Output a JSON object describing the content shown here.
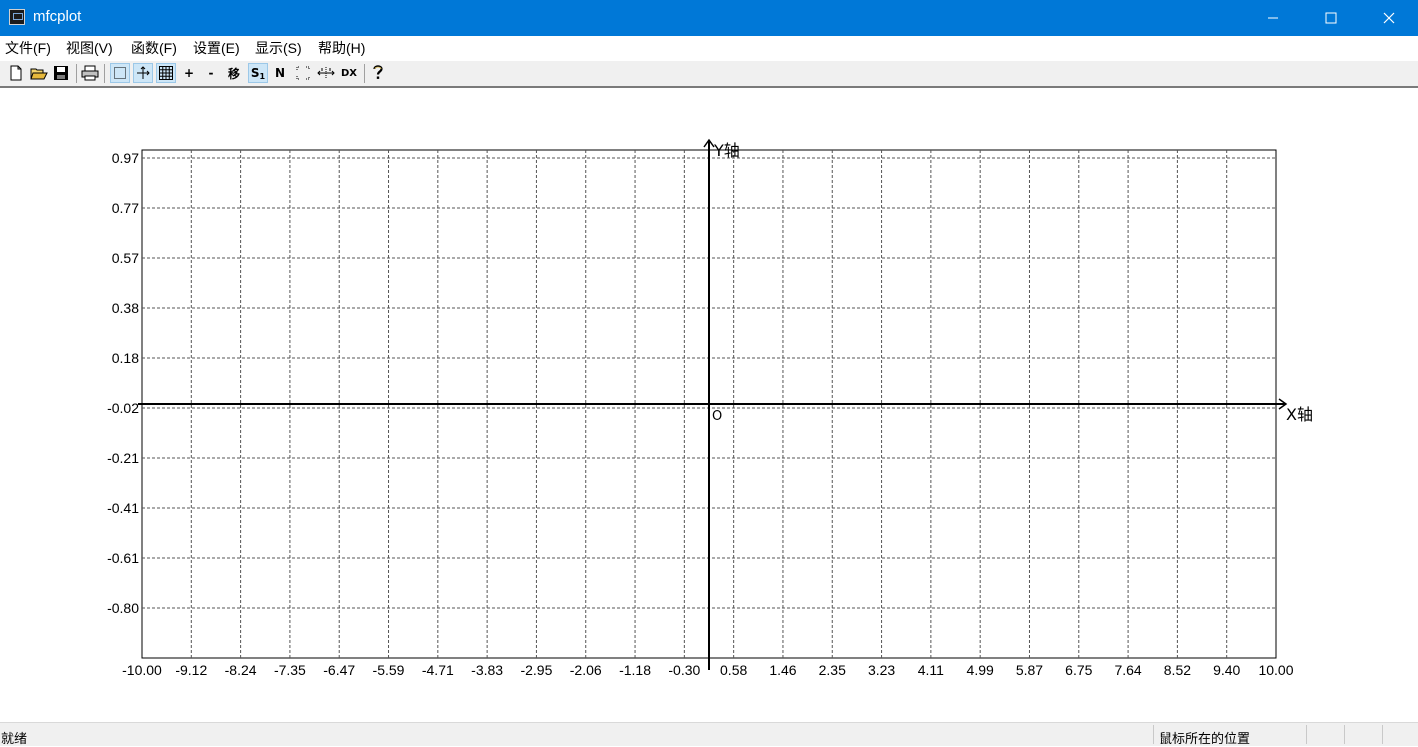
{
  "window": {
    "title": "mfcplot",
    "minimize_icon": "minimize-icon",
    "maximize_icon": "maximize-icon",
    "close_icon": "close-icon"
  },
  "menu": [
    {
      "label": "文件(F)"
    },
    {
      "label": "视图(V)"
    },
    {
      "label": "函数(F)"
    },
    {
      "label": "设置(E)"
    },
    {
      "label": "显示(S)"
    },
    {
      "label": "帮助(H)"
    }
  ],
  "toolbar": {
    "new_icon": "new-file-icon",
    "open_icon": "open-folder-icon",
    "save_icon": "save-icon",
    "print_icon": "print-icon",
    "select_icon": "select-rect-icon",
    "axis_icon": "axis-icon",
    "grid_icon": "grid-icon",
    "zoom_in": "+",
    "zoom_out": "-",
    "move": "移",
    "s_label": "S",
    "s_sub": "1",
    "n_label": "N",
    "dx_label": "DX",
    "help_icon": "help-icon"
  },
  "chart_data": {
    "type": "line",
    "xlabel": "X轴",
    "ylabel": "Y轴",
    "origin_label": "O",
    "xlim": [
      -10.0,
      10.0
    ],
    "ylim": [
      -1.0,
      0.97
    ],
    "grid": true,
    "x_tick_labels": [
      "-10.00",
      "-9.12",
      "-8.24",
      "-7.35",
      "-6.47",
      "-5.59",
      "-4.71",
      "-3.83",
      "-2.95",
      "-2.06",
      "-1.18",
      "-0.30",
      "0.58",
      "1.46",
      "2.35",
      "3.23",
      "4.11",
      "4.99",
      "5.87",
      "6.75",
      "7.64",
      "8.52",
      "9.40",
      "10.00"
    ],
    "y_tick_labels": [
      "0.97",
      "0.77",
      "0.57",
      "0.38",
      "0.18",
      "-0.02",
      "-0.21",
      "-0.41",
      "-0.61",
      "-0.80"
    ],
    "series": []
  },
  "status": {
    "ready": "就绪",
    "mouse_position": "鼠标所在的位置"
  }
}
